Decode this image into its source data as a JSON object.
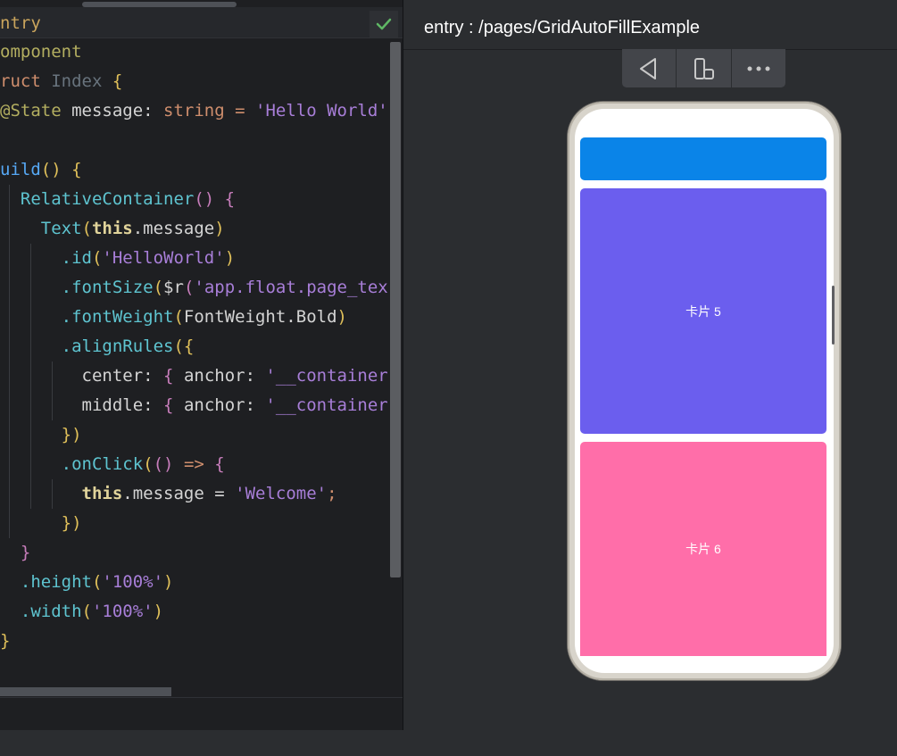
{
  "editor": {
    "tab_label": "ntry",
    "check_icon_glyph": "✔",
    "lines": [
      [
        {
          "t": "omponent",
          "c": "ann"
        }
      ],
      [
        {
          "t": "ruct ",
          "c": "kw"
        },
        {
          "t": "Index ",
          "c": "cls2"
        },
        {
          "t": "{",
          "c": "br1"
        }
      ],
      [
        {
          "t": "@State ",
          "c": "ann"
        },
        {
          "t": "message",
          "c": "plain"
        },
        {
          "t": ": ",
          "c": "plain"
        },
        {
          "t": "string",
          "c": "kw"
        },
        {
          "t": " = ",
          "c": "kw"
        },
        {
          "t": "'Hello World'",
          "c": "str"
        }
      ],
      [],
      [
        {
          "t": "uild",
          "c": "fn"
        },
        {
          "t": "() ",
          "c": "br1"
        },
        {
          "t": "{",
          "c": "br1"
        }
      ],
      [
        {
          "t": "  RelativeContainer",
          "c": "attr"
        },
        {
          "t": "() ",
          "c": "br2"
        },
        {
          "t": "{",
          "c": "br2"
        }
      ],
      [
        {
          "t": "    Text",
          "c": "attr"
        },
        {
          "t": "(",
          "c": "br1"
        },
        {
          "t": "this",
          "c": "this"
        },
        {
          "t": ".message",
          "c": "plain"
        },
        {
          "t": ")",
          "c": "br1"
        }
      ],
      [
        {
          "t": "      .id",
          "c": "attr"
        },
        {
          "t": "(",
          "c": "br1"
        },
        {
          "t": "'HelloWorld'",
          "c": "str"
        },
        {
          "t": ")",
          "c": "br1"
        }
      ],
      [
        {
          "t": "      .fontSize",
          "c": "attr"
        },
        {
          "t": "(",
          "c": "br1"
        },
        {
          "t": "$r",
          "c": "plain"
        },
        {
          "t": "(",
          "c": "br2"
        },
        {
          "t": "'app.float.page_tex",
          "c": "str"
        }
      ],
      [
        {
          "t": "      .fontWeight",
          "c": "attr"
        },
        {
          "t": "(",
          "c": "br1"
        },
        {
          "t": "FontWeight.Bold",
          "c": "plain"
        },
        {
          "t": ")",
          "c": "br1"
        }
      ],
      [
        {
          "t": "      .alignRules",
          "c": "attr"
        },
        {
          "t": "({",
          "c": "br1"
        }
      ],
      [
        {
          "t": "        center",
          "c": "plain"
        },
        {
          "t": ": ",
          "c": "plain"
        },
        {
          "t": "{ ",
          "c": "br2"
        },
        {
          "t": "anchor",
          "c": "plain"
        },
        {
          "t": ": ",
          "c": "plain"
        },
        {
          "t": "'__container",
          "c": "str"
        }
      ],
      [
        {
          "t": "        middle",
          "c": "plain"
        },
        {
          "t": ": ",
          "c": "plain"
        },
        {
          "t": "{ ",
          "c": "br2"
        },
        {
          "t": "anchor",
          "c": "plain"
        },
        {
          "t": ": ",
          "c": "plain"
        },
        {
          "t": "'__container",
          "c": "str"
        }
      ],
      [
        {
          "t": "      })",
          "c": "br1"
        }
      ],
      [
        {
          "t": "      .onClick",
          "c": "attr"
        },
        {
          "t": "(",
          "c": "br1"
        },
        {
          "t": "() ",
          "c": "br2"
        },
        {
          "t": "=> ",
          "c": "kw"
        },
        {
          "t": "{",
          "c": "br2"
        }
      ],
      [
        {
          "t": "        this",
          "c": "this"
        },
        {
          "t": ".message = ",
          "c": "plain"
        },
        {
          "t": "'Welcome'",
          "c": "str"
        },
        {
          "t": ";",
          "c": "kw"
        }
      ],
      [
        {
          "t": "      })",
          "c": "br1"
        }
      ],
      [
        {
          "t": "  }",
          "c": "br2"
        }
      ],
      [
        {
          "t": "  .height",
          "c": "attr"
        },
        {
          "t": "(",
          "c": "br1"
        },
        {
          "t": "'100%'",
          "c": "str"
        },
        {
          "t": ")",
          "c": "br1"
        }
      ],
      [
        {
          "t": "  .width",
          "c": "attr"
        },
        {
          "t": "(",
          "c": "br1"
        },
        {
          "t": "'100%'",
          "c": "str"
        },
        {
          "t": ")",
          "c": "br1"
        }
      ],
      [
        {
          "t": "}",
          "c": "br1"
        }
      ]
    ]
  },
  "preview": {
    "title": "entry : /pages/GridAutoFillExample",
    "toolbar": {
      "back_glyph": "◁",
      "rotate_glyph": "▯",
      "more_glyph": "•••"
    },
    "cards": [
      {
        "label": "",
        "color": "#0a84e8"
      },
      {
        "label": "卡片 5",
        "color": "#6b5eee"
      },
      {
        "label": "卡片 6",
        "color": "#ff6ea9"
      }
    ]
  }
}
